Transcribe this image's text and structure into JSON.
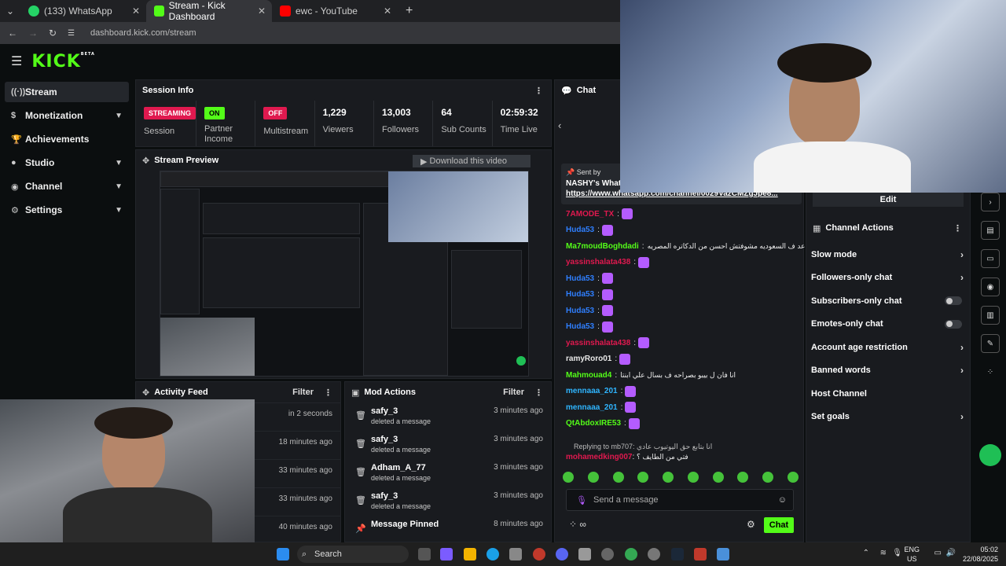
{
  "browser": {
    "tabs": [
      {
        "label": "(133) WhatsApp",
        "color": "#25d366",
        "active": false
      },
      {
        "label": "Stream - Kick Dashboard",
        "color": "#53fc18",
        "active": true
      },
      {
        "label": "ewc - YouTube",
        "color": "#ff0000",
        "active": false
      }
    ],
    "url": "dashboard.kick.com/stream"
  },
  "header": {
    "logo": "KICK",
    "beta": "BETA"
  },
  "sidebar": {
    "items": [
      {
        "label": "Stream",
        "icon": "radio-icon",
        "selected": true
      },
      {
        "label": "Monetization",
        "icon": "dollar-icon",
        "chevron": true
      },
      {
        "label": "Achievements",
        "icon": "trophy-icon"
      },
      {
        "label": "Studio",
        "icon": "mic-icon",
        "chevron": true
      },
      {
        "label": "Channel",
        "icon": "user-icon",
        "chevron": true
      },
      {
        "label": "Settings",
        "icon": "gear-icon",
        "chevron": true
      }
    ]
  },
  "session": {
    "title": "Session Info",
    "stats": [
      {
        "badge": "STREAMING",
        "badge_color": "red",
        "label": "Session"
      },
      {
        "badge": "ON",
        "badge_color": "green",
        "label": "Partner Income"
      },
      {
        "badge": "OFF",
        "badge_color": "red",
        "label": "Multistream"
      },
      {
        "value": "1,229",
        "label": "Viewers"
      },
      {
        "value": "13,003",
        "label": "Followers"
      },
      {
        "value": "64",
        "label": "Sub Counts"
      },
      {
        "value": "02:59:32",
        "label": "Time Live"
      }
    ]
  },
  "preview": {
    "title": "Stream Preview",
    "download": "Download this video"
  },
  "activity": {
    "title": "Activity Feed",
    "filter": "Filter",
    "rows": [
      "in 2 seconds",
      "18 minutes ago",
      "33 minutes ago",
      "33 minutes ago",
      "40 minutes ago"
    ]
  },
  "mod": {
    "title": "Mod Actions",
    "filter": "Filter",
    "rows": [
      {
        "user": "safy_3",
        "action": "deleted a message",
        "time": "3 minutes ago"
      },
      {
        "user": "safy_3",
        "action": "deleted a message",
        "time": "3 minutes ago"
      },
      {
        "user": "Adham_A_77",
        "action": "deleted a message",
        "time": "3 minutes ago"
      },
      {
        "user": "safy_3",
        "action": "deleted a message",
        "time": "3 minutes ago"
      },
      {
        "user": "Message Pinned",
        "action": "",
        "time": "8 minutes ago"
      }
    ]
  },
  "chat": {
    "title": "Chat",
    "pinned": {
      "sent_by": "Sent by",
      "title": "NASHY's Whats",
      "link": "https://www.whatsapp.com/channel/0029VazCMZgJpe8..."
    },
    "messages": [
      {
        "name": "7AMODE_TX",
        "color": "#e0194f",
        "text": ""
      },
      {
        "name": "Huda53",
        "color": "#2f7fff",
        "text": ""
      },
      {
        "name": "Ma7moudBoghdadi",
        "color": "#53fc18",
        "text": "انا قاعد ف السعوديه مشوفتش احسن من الدكاتره المصريه"
      },
      {
        "name": "yassinshalata438",
        "color": "#e0194f",
        "text": ""
      },
      {
        "name": "Huda53",
        "color": "#2f7fff",
        "text": ""
      },
      {
        "name": "Huda53",
        "color": "#2f7fff",
        "text": ""
      },
      {
        "name": "Huda53",
        "color": "#2f7fff",
        "text": ""
      },
      {
        "name": "Huda53",
        "color": "#2f7fff",
        "text": ""
      },
      {
        "name": "yassinshalata438",
        "color": "#e0194f",
        "text": ""
      },
      {
        "name": "ramyRoro01",
        "color": "#e8e8e8",
        "text": ""
      },
      {
        "name": "Mahmouad4",
        "color": "#53fc18",
        "text": "انا فان ل بيبو بصراحه ف بسال علي ابنتا"
      },
      {
        "name": "mennaaa_201",
        "color": "#2fb5ff",
        "text": ""
      },
      {
        "name": "mennaaa_201",
        "color": "#2fb5ff",
        "text": ""
      },
      {
        "name": "QtAbdoxIRE53",
        "color": "#53fc18",
        "text": ""
      }
    ],
    "reply": "Replying to mb707: انا بتابع حق اليوتيوب عادي",
    "last": {
      "name": "mohamedking007",
      "color": "#e0194f",
      "text": "فتي من الطايف ؟"
    },
    "input_placeholder": "Send a message",
    "send": "Chat"
  },
  "channel_actions": {
    "edit": "Edit",
    "title": "Channel Actions",
    "items": [
      {
        "label": "Slow mode",
        "kind": "chevron"
      },
      {
        "label": "Followers-only chat",
        "kind": "chevron"
      },
      {
        "label": "Subscribers-only chat",
        "kind": "toggle"
      },
      {
        "label": "Emotes-only chat",
        "kind": "toggle"
      },
      {
        "label": "Account age restriction",
        "kind": "chevron"
      },
      {
        "label": "Banned words",
        "kind": "chevron"
      },
      {
        "label": "Host Channel",
        "kind": "none"
      },
      {
        "label": "Set goals",
        "kind": "chevron"
      }
    ]
  },
  "taskbar": {
    "search": "Search",
    "lang": [
      "ENG",
      "US"
    ],
    "time": "05:02",
    "date": "22/08/2025"
  }
}
